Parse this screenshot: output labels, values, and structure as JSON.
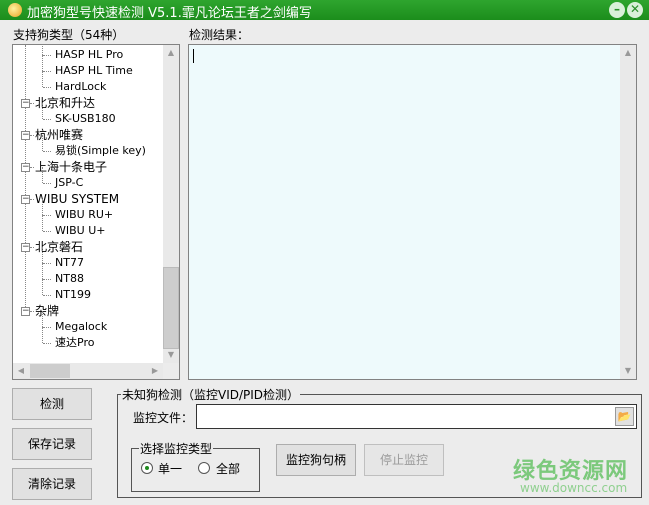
{
  "window": {
    "title": "加密狗型号快速检测 V5.1.霏凡论坛王者之剑编写",
    "minimize": "–",
    "close": "✕"
  },
  "left": {
    "heading": "支持狗类型（54种）",
    "tree": [
      {
        "label": "HASP HL Pro",
        "level": 2
      },
      {
        "label": "HASP HL Time",
        "level": 2
      },
      {
        "label": "HardLock",
        "level": 2
      },
      {
        "label": "北京和升达",
        "level": 1
      },
      {
        "label": "SK-USB180",
        "level": 2
      },
      {
        "label": "杭州唯赛",
        "level": 1
      },
      {
        "label": "易锁(Simple key)",
        "level": 2
      },
      {
        "label": "上海十条电子",
        "level": 1
      },
      {
        "label": "JSP-C",
        "level": 2
      },
      {
        "label": "WIBU SYSTEM",
        "level": 1
      },
      {
        "label": "WIBU RU+",
        "level": 2
      },
      {
        "label": "WIBU U+",
        "level": 2
      },
      {
        "label": "北京磐石",
        "level": 1
      },
      {
        "label": "NT77",
        "level": 2
      },
      {
        "label": "NT88",
        "level": 2
      },
      {
        "label": "NT199",
        "level": 2
      },
      {
        "label": "杂牌",
        "level": 1
      },
      {
        "label": "Megalock",
        "level": 2
      },
      {
        "label": "速达Pro",
        "level": 2
      }
    ],
    "scroll_position": 0.85
  },
  "result": {
    "heading": "检测结果：",
    "text": ""
  },
  "buttons": {
    "detect": "检测",
    "save": "保存记录",
    "clear": "清除记录"
  },
  "unknown": {
    "group_label": "未知狗检测（监控VID/PID检测）",
    "file_label": "监控文件：",
    "file_value": "",
    "type_group_label": "选择监控类型",
    "radio_single": "单一",
    "radio_all": "全部",
    "selected": "single",
    "monitor_button": "监控狗句柄",
    "stop_button": "停止监控"
  },
  "watermark": {
    "title": "绿色资源网",
    "url": "www.downcc.com"
  },
  "colors": {
    "titlebar": "#1f961f",
    "result_bg": "#eefafc",
    "watermark": "#7cc97c"
  }
}
